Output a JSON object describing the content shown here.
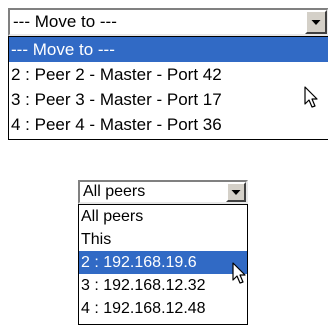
{
  "move_to_dropdown": {
    "selected": "--- Move to ---",
    "options": [
      "--- Move to ---",
      "2 : Peer 2 - Master - Port 42",
      "3 : Peer 3 - Master - Port 17",
      "4 : Peer 4 - Master - Port 36"
    ],
    "highlighted_index": 0
  },
  "peers_dropdown": {
    "selected": "All peers",
    "options": [
      "All peers",
      "This",
      "2 : 192.168.19.6",
      "3 : 192.168.12.32",
      "4 : 192.168.12.48"
    ],
    "highlighted_index": 2
  },
  "colors": {
    "highlight": "#316ac5",
    "highlight_text": "#ffffff",
    "button_face": "#d4d0c8"
  },
  "icons": [
    "chevron-down-icon",
    "mouse-pointer-icon"
  ]
}
